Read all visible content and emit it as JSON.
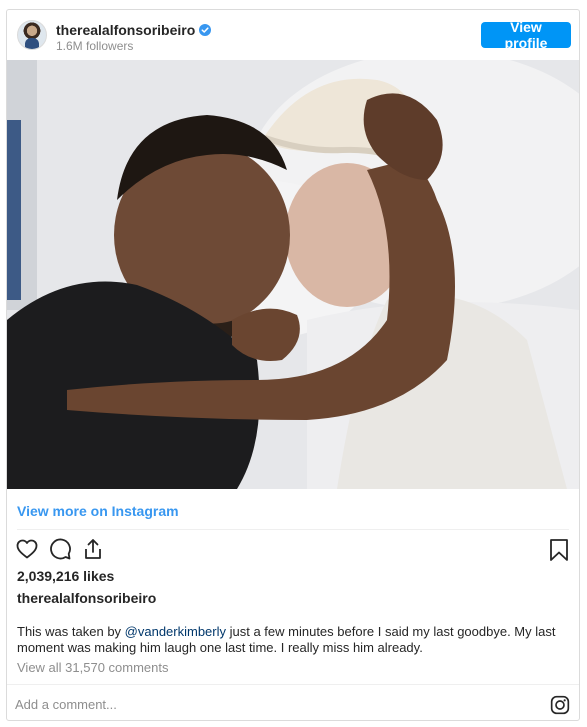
{
  "header": {
    "username": "therealalfonsoribeiro",
    "followers": "1.6M followers",
    "view_profile_label": "View profile",
    "verified_color": "#3897f0"
  },
  "post": {
    "view_more_label": "View more on Instagram",
    "likes": "2,039,216 likes",
    "caption_username": "therealalfonsoribeiro",
    "caption_before": "This was taken by ",
    "caption_mention": "@vanderkimberly",
    "caption_after": " just a few minutes before I said my last goodbye. My last moment was making him laugh one last time. I really miss him already.",
    "view_comments": "View all 31,570 comments",
    "comment_placeholder": "Add a comment..."
  },
  "icons": {
    "like": "heart-icon",
    "comment": "comment-icon",
    "share": "share-icon",
    "save": "bookmark-icon",
    "instagram": "instagram-icon"
  },
  "colors": {
    "accent": "#0095f6",
    "link": "#3897f0",
    "mention": "#00376b"
  }
}
